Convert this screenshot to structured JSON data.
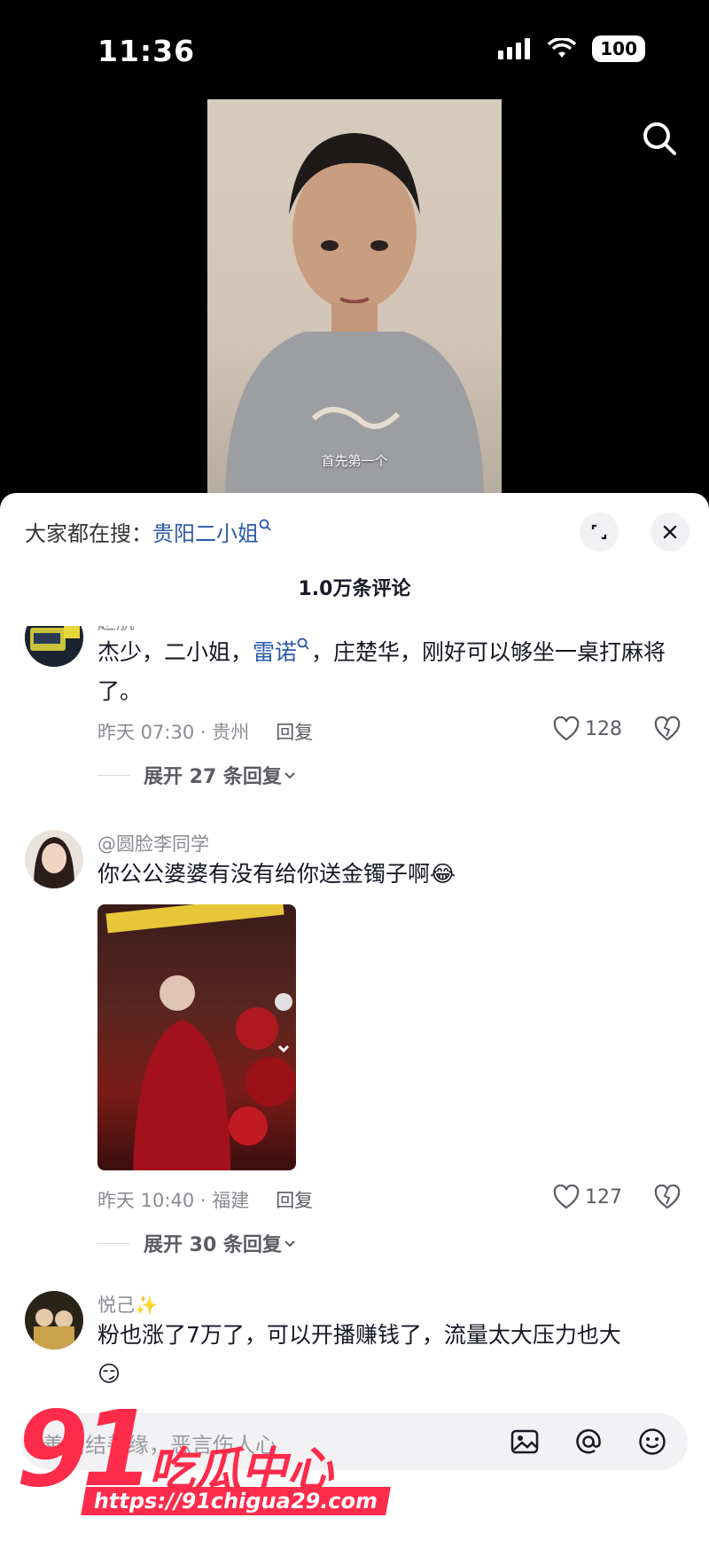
{
  "status": {
    "time": "11:36",
    "battery": "100"
  },
  "video": {
    "subtitle": "首先第一个"
  },
  "sheet": {
    "trending_prefix": "大家都在搜：",
    "trending_query": "贵阳二小姐",
    "comment_count": "1.0万条评论"
  },
  "comments": [
    {
      "username": "赵航",
      "text_before": "杰少，二小姐，",
      "keyword": "雷诺",
      "text_after": "，庄楚华，刚好可以够坐一桌打麻将了。",
      "time_loc": "昨天 07:30 · 贵州",
      "reply": "回复",
      "likes": "128",
      "expand": "展开 27 条回复"
    },
    {
      "username": "@圆脸李同学",
      "text": "你公公婆婆有没有给你送金镯子啊",
      "emoji": "😂",
      "time_loc": "昨天 10:40 · 福建",
      "reply": "回复",
      "likes": "127",
      "expand": "展开 30 条回复"
    },
    {
      "username": "悦己",
      "sparkle": "✨",
      "text": "粉也涨了7万了，可以开播赚钱了，流量太大压力也大",
      "emoji": "😏"
    }
  ],
  "input": {
    "placeholder": "善语结善缘，恶言伤人心"
  },
  "watermark": {
    "number": "91",
    "cn": "吃瓜中心",
    "url": "https://91chigua29.com"
  },
  "colors": {
    "accent_link": "#2a5aa8",
    "watermark_red": "#ff2b4a",
    "sheet_bg": "#ffffff"
  },
  "icons": [
    "search-icon",
    "expand-icon",
    "close-icon",
    "heart-icon",
    "dislike-icon",
    "chevron-down-icon",
    "image-icon",
    "at-icon",
    "emoji-icon"
  ]
}
